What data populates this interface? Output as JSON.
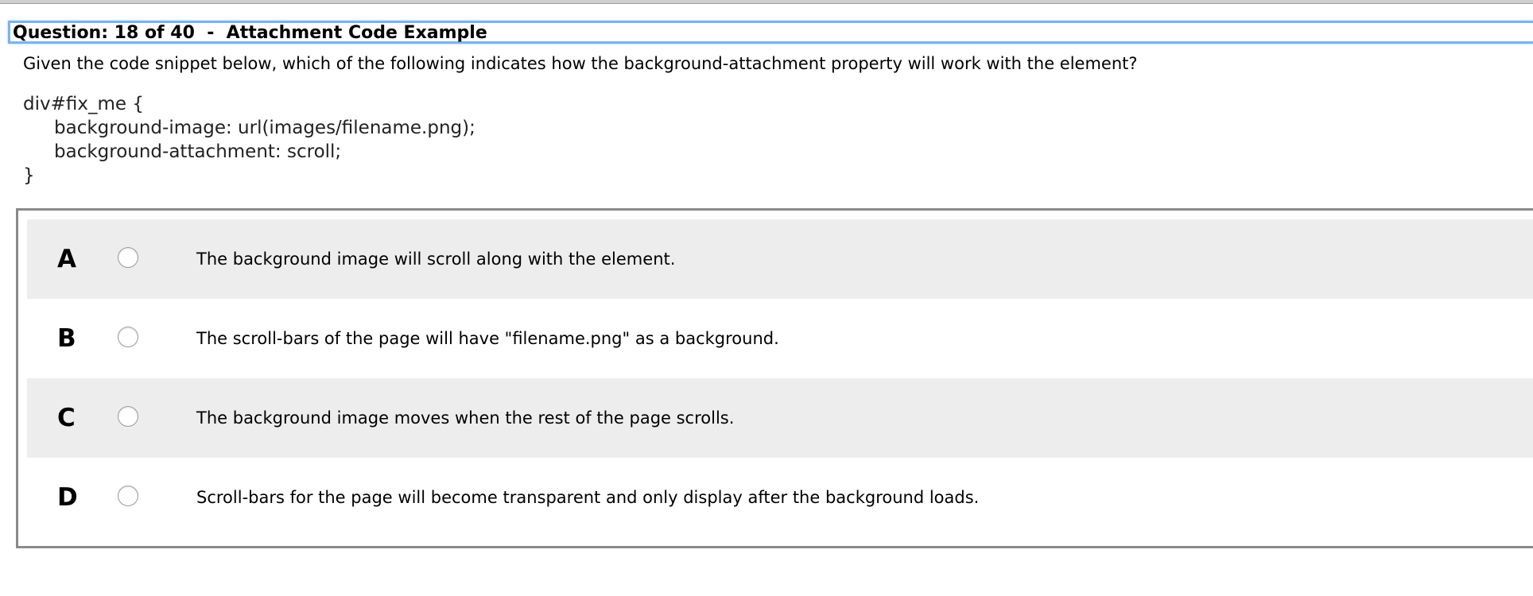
{
  "header": {
    "title": "Question: 18 of 40  -  Attachment Code Example"
  },
  "question": {
    "prompt": "Given the code snippet below, which of the following indicates how the background-attachment property will work with the element?",
    "code": {
      "line1": "div#fix_me {",
      "line2": "background-image: url(images/filename.png);",
      "line3": "background-attachment: scroll;",
      "line4": "}"
    }
  },
  "options": [
    {
      "letter": "A",
      "text": "The background image will scroll along with the element."
    },
    {
      "letter": "B",
      "text": "The scroll-bars of the page will have \"filename.png\" as a background."
    },
    {
      "letter": "C",
      "text": "The background image moves when the rest of the page scrolls."
    },
    {
      "letter": "D",
      "text": "Scroll-bars for the page will become transparent and only display after the background loads."
    }
  ],
  "colors": {
    "title_border": "#7ab3ec",
    "row_shade": "#ededed",
    "panel_border": "#8a8a8a"
  }
}
